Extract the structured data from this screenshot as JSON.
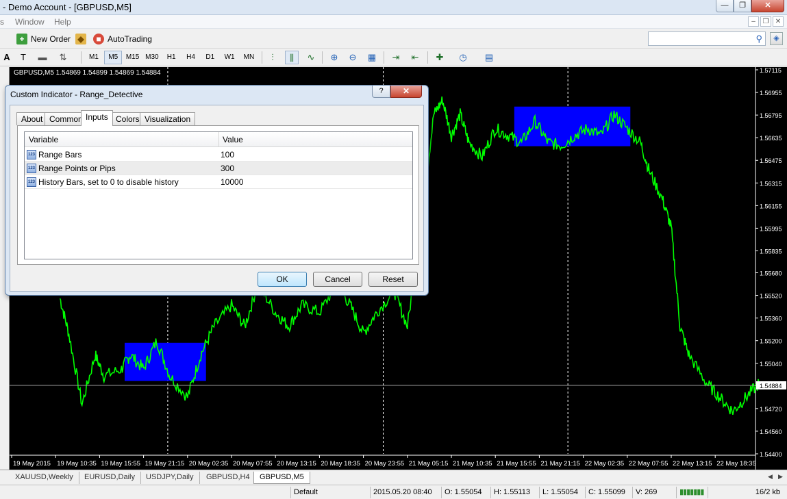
{
  "window": {
    "title": "- Demo Account - [GBPUSD,M5]",
    "controls": {
      "minimize": "—",
      "restore": "❐",
      "close": "✕"
    }
  },
  "menu": {
    "items": [
      "s",
      "Window",
      "Help"
    ],
    "mdi": {
      "minimize": "–",
      "restore": "❐",
      "close": "✕"
    }
  },
  "toolbar": {
    "new_order": "New Order",
    "autotrading": "AutoTrading",
    "search_placeholder": ""
  },
  "timeframes": [
    "M1",
    "M5",
    "M15",
    "M30",
    "H1",
    "H4",
    "D1",
    "W1",
    "MN"
  ],
  "active_timeframe": "M5",
  "chart": {
    "header": "GBPUSD,M5  1.54869 1.54899 1.54869 1.54884",
    "line_color": "#00ff00",
    "box_color": "#0000ff",
    "current_price_label": "1.54884"
  },
  "chart_data": {
    "type": "line",
    "symbol": "GBPUSD",
    "timeframe": "M5",
    "ohlc": {
      "open": 1.54869,
      "high": 1.54899,
      "low": 1.54869,
      "close": 1.54884
    },
    "ylim": [
      1.544,
      1.57115
    ],
    "y_ticks": [
      "1.57115",
      "1.56955",
      "1.56795",
      "1.56635",
      "1.56475",
      "1.56315",
      "1.56155",
      "1.55995",
      "1.55835",
      "1.55680",
      "1.55520",
      "1.55360",
      "1.55200",
      "1.55040",
      "1.54884",
      "1.54720",
      "1.54560",
      "1.54400"
    ],
    "x_ticks": [
      "19 May 2015",
      "19 May 10:35",
      "19 May 15:55",
      "19 May 21:15",
      "20 May 02:35",
      "20 May 07:55",
      "20 May 13:15",
      "20 May 18:35",
      "20 May 23:55",
      "21 May 05:15",
      "21 May 10:35",
      "21 May 15:55",
      "21 May 21:15",
      "22 May 02:35",
      "22 May 07:55",
      "22 May 13:15",
      "22 May 18:35"
    ],
    "series": [
      {
        "x_index": [
          1.1,
          1.3,
          1.6,
          1.9,
          2.1,
          2.5,
          2.7,
          3.0,
          3.3,
          3.6,
          4.0,
          4.3,
          4.6,
          5.0,
          5.3,
          5.6,
          6.0,
          6.3,
          6.6,
          7.0,
          7.4,
          7.7,
          8.0,
          8.3,
          8.7,
          9.0,
          9.3,
          9.6,
          9.8,
          10.0,
          10.2,
          10.4,
          10.7,
          11.0,
          11.3,
          11.6,
          11.9,
          12.2,
          12.5,
          12.8,
          13.1,
          13.4,
          13.7,
          14.0,
          14.3,
          14.5,
          14.8,
          15.0,
          15.2,
          15.4,
          15.8,
          16.1,
          16.4,
          16.7,
          17.0
        ],
        "values": [
          1.555,
          1.5525,
          1.5475,
          1.551,
          1.5495,
          1.55,
          1.551,
          1.55,
          1.552,
          1.5495,
          1.548,
          1.551,
          1.553,
          1.5545,
          1.553,
          1.556,
          1.554,
          1.553,
          1.5545,
          1.554,
          1.556,
          1.5545,
          1.5525,
          1.554,
          1.5555,
          1.553,
          1.56,
          1.568,
          1.569,
          1.5665,
          1.568,
          1.566,
          1.565,
          1.567,
          1.5665,
          1.566,
          1.5675,
          1.566,
          1.5658,
          1.5665,
          1.567,
          1.5665,
          1.568,
          1.567,
          1.566,
          1.564,
          1.562,
          1.56,
          1.553,
          1.551,
          1.549,
          1.548,
          1.547,
          1.548,
          1.549
        ]
      }
    ],
    "range_boxes": [
      {
        "x_index": [
          2.57,
          4.42
        ],
        "price": [
          1.54915,
          1.55185
        ]
      },
      {
        "x_index": [
          11.43,
          14.07
        ],
        "price": [
          1.56575,
          1.56855
        ]
      }
    ],
    "grid": false
  },
  "dialog": {
    "title": "Custom Indicator - Range_Detective",
    "help": "?",
    "close": "✕",
    "tabs": [
      "About",
      "Common",
      "Inputs",
      "Colors",
      "Visualization"
    ],
    "active_tab": "Inputs",
    "columns": {
      "variable": "Variable",
      "value": "Value"
    },
    "rows": [
      {
        "icon": "123",
        "name": "Range Bars",
        "value": "100"
      },
      {
        "icon": "123",
        "name": "Range Points or Pips",
        "value": "300"
      },
      {
        "icon": "123",
        "name": "History Bars, set to 0 to disable history",
        "value": "10000"
      }
    ],
    "ok": "OK",
    "cancel": "Cancel",
    "reset": "Reset"
  },
  "chart_tabs": [
    "XAUUSD,Weekly",
    "EURUSD,Daily",
    "USDJPY,Daily",
    "GBPUSD,H4",
    "GBPUSD,M5"
  ],
  "active_chart_tab": "GBPUSD,M5",
  "status": {
    "profile": "Default",
    "datetime": "2015.05.20 08:40",
    "open": "O: 1.55054",
    "high": "H: 1.55113",
    "low": "L: 1.55054",
    "close": "C: 1.55099",
    "volume": "V: 269",
    "traffic": "16/2 kb"
  }
}
